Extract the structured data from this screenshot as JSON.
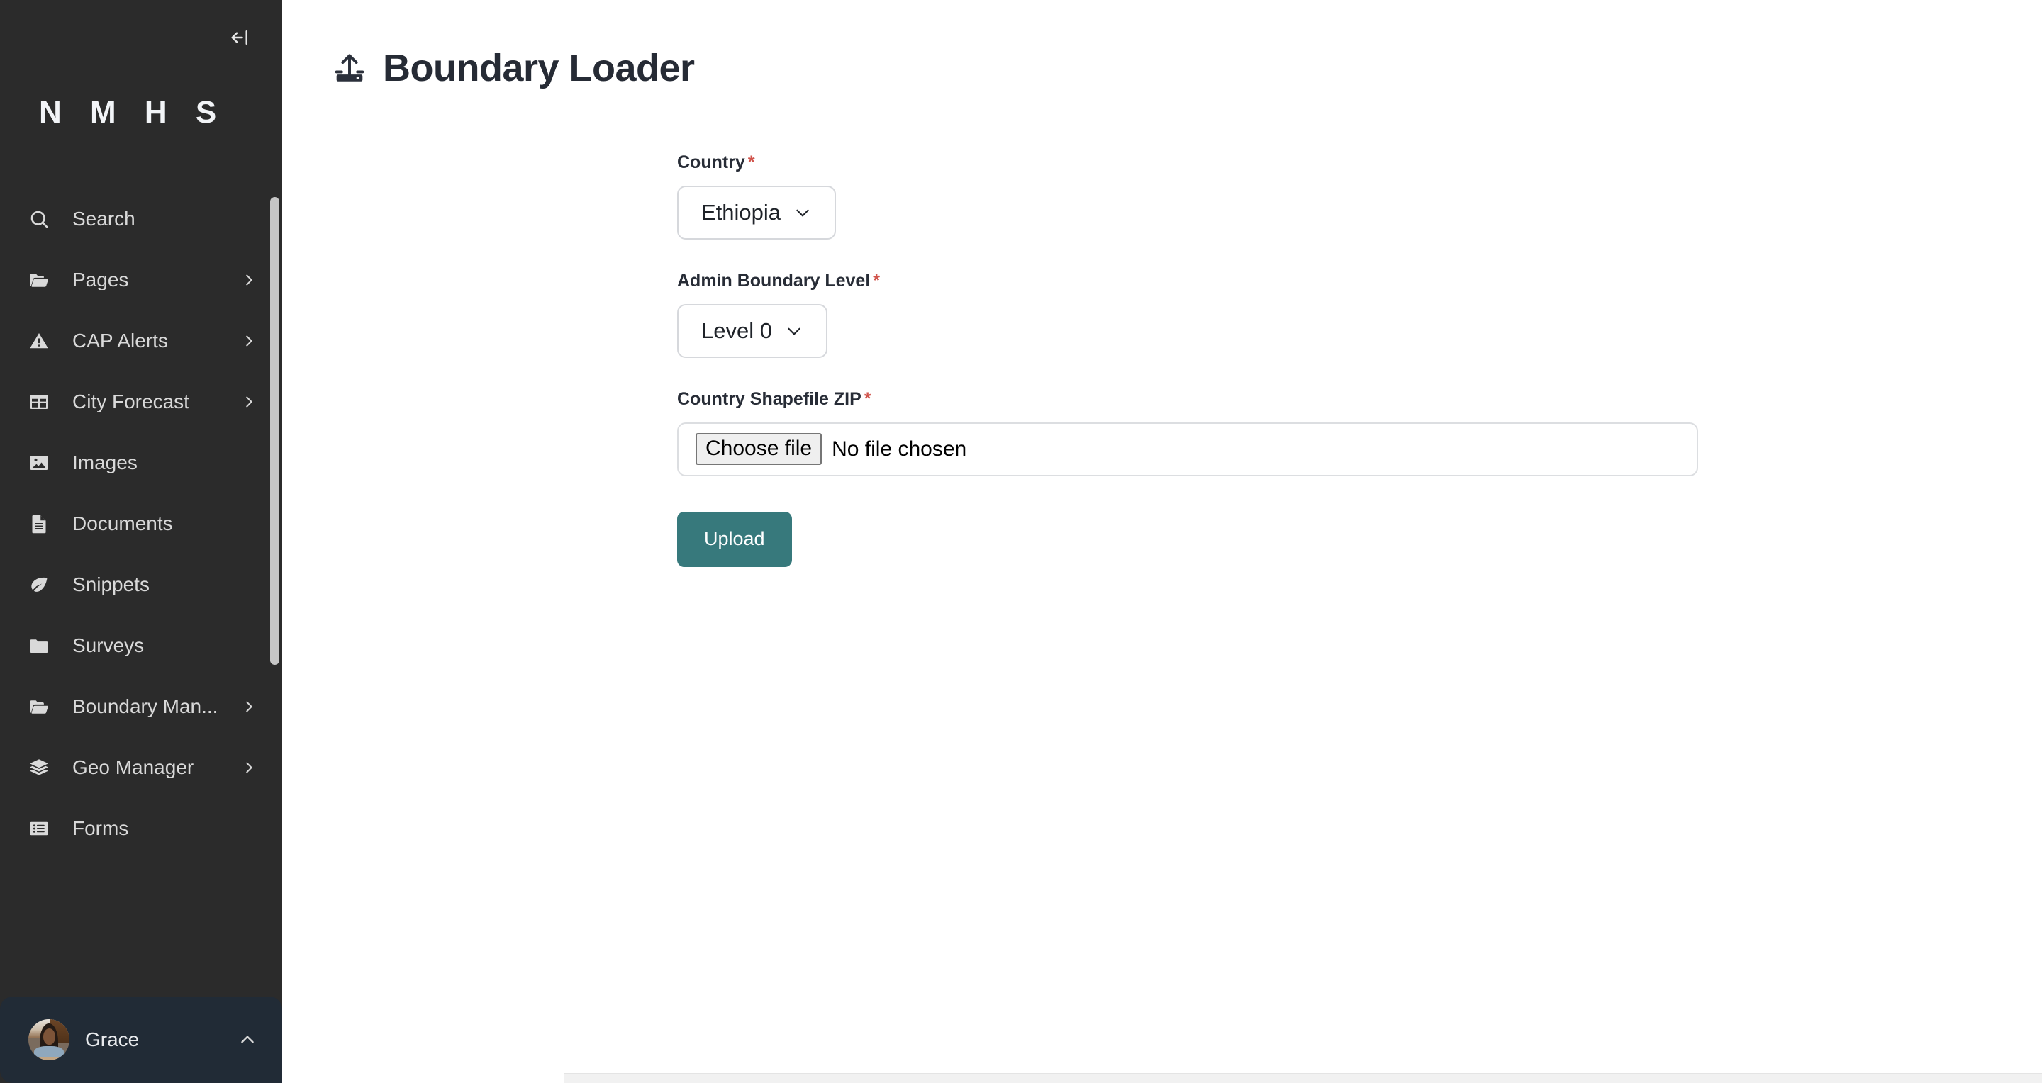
{
  "sidebar": {
    "brand": "N M H S",
    "collapse_icon": "panel-collapse-left-icon",
    "items": [
      {
        "label": "Search",
        "icon": "search-icon",
        "has_chevron": false
      },
      {
        "label": "Pages",
        "icon": "folder-open-icon",
        "has_chevron": true
      },
      {
        "label": "CAP Alerts",
        "icon": "warning-triangle-icon",
        "has_chevron": true
      },
      {
        "label": "City Forecast",
        "icon": "table-icon",
        "has_chevron": true
      },
      {
        "label": "Images",
        "icon": "image-icon",
        "has_chevron": false
      },
      {
        "label": "Documents",
        "icon": "document-icon",
        "has_chevron": false
      },
      {
        "label": "Snippets",
        "icon": "leaf-icon",
        "has_chevron": false
      },
      {
        "label": "Surveys",
        "icon": "folder-icon",
        "has_chevron": false
      },
      {
        "label": "Boundary Man...",
        "icon": "folder-open-icon",
        "has_chevron": true
      },
      {
        "label": "Geo Manager",
        "icon": "layers-icon",
        "has_chevron": true
      },
      {
        "label": "Forms",
        "icon": "list-icon",
        "has_chevron": false
      }
    ],
    "footer": {
      "user_name": "Grace",
      "avatar": "user-avatar-photo",
      "chevron": "chevron-up-icon"
    }
  },
  "header": {
    "title": "Boundary Loader",
    "icon": "upload-drive-icon"
  },
  "form": {
    "required_marker": "*",
    "country": {
      "label": "Country",
      "value": "Ethiopia",
      "chevron": "chevron-down-icon"
    },
    "admin_level": {
      "label": "Admin Boundary Level",
      "value": "Level 0",
      "chevron": "chevron-down-icon"
    },
    "shapefile": {
      "label": "Country Shapefile ZIP",
      "button_label": "Choose file",
      "status": "No file chosen"
    },
    "submit_label": "Upload"
  },
  "colors": {
    "sidebar_bg": "#2b2b2b",
    "sidebar_footer_bg": "#212b36",
    "accent_teal": "#37797c",
    "required_red": "#d1544c",
    "title_dark": "#262b35"
  }
}
